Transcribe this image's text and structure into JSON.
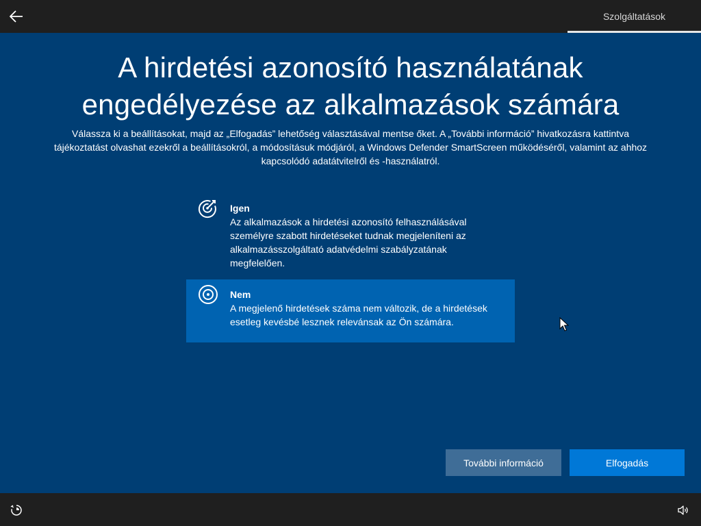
{
  "header": {
    "tab_label": "Szolgáltatások"
  },
  "main": {
    "title_line1": "A hirdetési azonosító használatának",
    "title_line2": "engedélyezése az alkalmazások számára",
    "description_line1": "Válassza ki a beállításokat, majd az „Elfogadás” lehetőség választásával mentse őket. A „További információ” hivatkozásra kattintva",
    "description_line2": "tájékoztatást olvashat ezekről a beállításokról, a módosításuk módjáról, a Windows Defender SmartScreen működéséről, valamint az ahhoz",
    "description_line3": "kapcsolódó adatátvitelről és -használatról."
  },
  "options": [
    {
      "title": "Igen",
      "icon": "target-arrow-icon",
      "lines": [
        "Az alkalmazások a hirdetési azonosító felhasználásával",
        "személyre szabott hirdetéseket tudnak megjeleníteni az",
        "alkalmazásszolgáltató adatvédelmi szabályzatának",
        "megfelelően."
      ],
      "selected": false
    },
    {
      "title": "Nem",
      "icon": "target-icon",
      "lines": [
        "A megjelenő hirdetések száma nem változik, de a hirdetések",
        "esetleg kevésbé lesznek relevánsak az Ön számára."
      ],
      "selected": true
    }
  ],
  "buttons": {
    "more_info": "További információ",
    "accept": "Elfogadás"
  },
  "colors": {
    "background": "#003e74",
    "selected_option": "#0063b1",
    "accent_button": "#0078d7",
    "secondary_button": "#3f6d97",
    "bars": "#1f1f1f"
  }
}
